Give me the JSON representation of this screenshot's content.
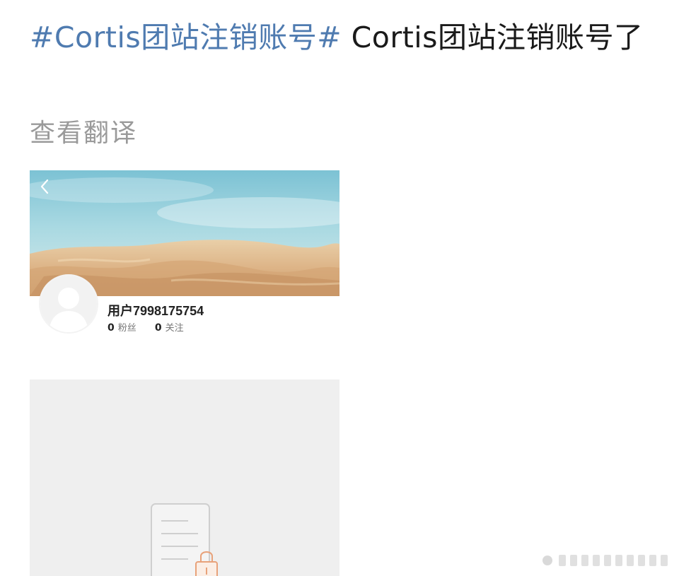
{
  "post": {
    "hashtag": "#Cortis团站注销账号#",
    "body": " Cortis团站注销账号了",
    "translate_label": "查看翻译"
  },
  "profile_card": {
    "username": "用户7998175754",
    "followers_count": "0",
    "followers_label": "粉丝",
    "following_count": "0",
    "following_label": "关注",
    "back_icon": "chevron-left-icon",
    "avatar_icon": "default-avatar-silhouette"
  },
  "locked_card": {
    "icon": "locked-document-icon"
  },
  "colors": {
    "hashtag": "#4f7bb0",
    "text": "#1a1a1a",
    "muted": "#9a9a9a",
    "lock_accent": "#e8a27a",
    "placeholder_bg": "#efefef"
  }
}
